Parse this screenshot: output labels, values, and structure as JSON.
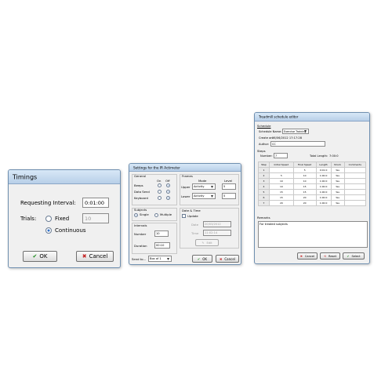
{
  "timings": {
    "title": "Timings",
    "requesting_interval_label": "Requesting Interval:",
    "requesting_interval_value": "0:01:00",
    "trials_label": "Trials:",
    "fixed_label": "Fixed",
    "fixed_value": "10",
    "continuous_label": "Continuous",
    "selected_trial_mode": "continuous",
    "ok_label": "OK",
    "cancel_label": "Cancel"
  },
  "settings": {
    "title": "Settings for the IR Actimeter",
    "general_label": "General",
    "on_label": "On",
    "off_label": "Off",
    "general_rows": [
      {
        "label": "Beeps",
        "on": false
      },
      {
        "label": "Data Send",
        "on": false
      },
      {
        "label": "Keyboard",
        "on": false
      }
    ],
    "frames_label": "Frames",
    "mode_label": "Mode",
    "level_label": "Level",
    "frames_rows": [
      {
        "label": "Upper",
        "mode": "Activity",
        "level": "5"
      },
      {
        "label": "Lower",
        "mode": "Activity",
        "level": "5"
      }
    ],
    "subjects_label": "Subjects",
    "single_label": "Single",
    "multiple_label": "Multiple",
    "subjects_selected": "single",
    "intervals_label": "Intervals",
    "number_label": "Number",
    "number_value": "10",
    "duration_label": "Duration",
    "duration_value": "00:10",
    "datetime_label": "Date & Time",
    "update_label": "Update",
    "date_label": "Date",
    "date_value": "20/03/2012",
    "time_label": "Time",
    "time_value": "11:02:14",
    "edit_label": "Edit",
    "send_to_label": "Send to...",
    "send_to_value": "Box of 1",
    "ok_label": "OK",
    "cancel_label": "Cancel"
  },
  "treadmill": {
    "title": "Treadmill schedule editor",
    "schedule_label": "Schedule",
    "schedule_name_label": "Schedule Name:",
    "schedule_name_value": "Exercise Training",
    "create_on_label": "Create on:",
    "create_on_value": "06/06/2012 17:17:28",
    "author_label": "Author:",
    "author_value": "CC",
    "steps_label": "Steps",
    "number_label": "Number:",
    "number_value": "7",
    "total_length_label": "Total Length:",
    "total_length_value": "7:00:0",
    "columns": [
      "Step",
      "Initial Speed",
      "Final Speed",
      "Length",
      "Shock",
      "Comments"
    ],
    "rows": [
      [
        "1",
        "",
        "5",
        "0:01:0",
        "Yes",
        ""
      ],
      [
        "2",
        "5",
        "10",
        "1:00:0",
        "Yes",
        ""
      ],
      [
        "3",
        "10",
        "10",
        "1:00:0",
        "Yes",
        ""
      ],
      [
        "4",
        "10",
        "15",
        "1:00:0",
        "Yes",
        ""
      ],
      [
        "5",
        "15",
        "15",
        "1:00:0",
        "Yes",
        ""
      ],
      [
        "6",
        "15",
        "20",
        "1:00:0",
        "Yes",
        ""
      ],
      [
        "7",
        "20",
        "20",
        "1:00:0",
        "Yes",
        ""
      ]
    ],
    "remarks_label": "Remarks",
    "remarks_value": "For treated subjects",
    "cancel_label": "Cancel",
    "reset_label": "Reset",
    "select_label": "Select"
  }
}
